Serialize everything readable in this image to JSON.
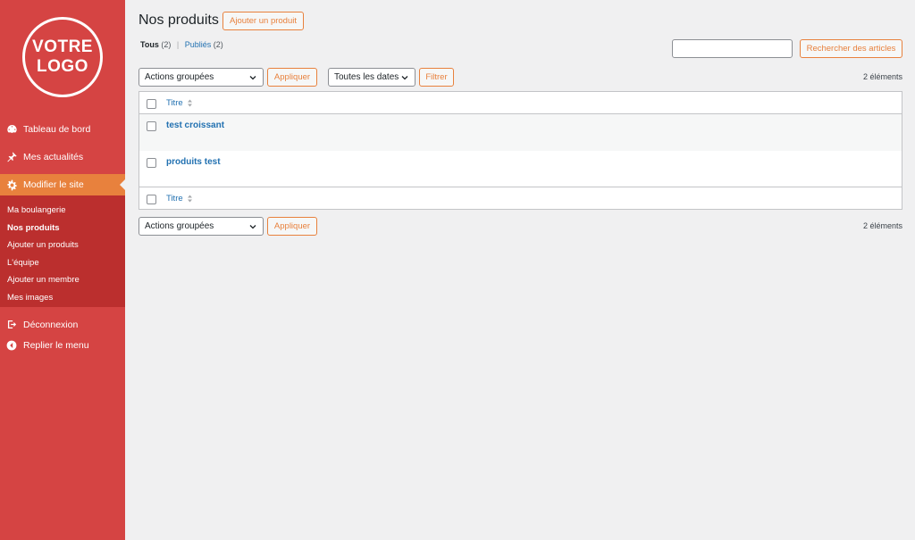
{
  "logo": {
    "line1": "VOTRE",
    "line2": "LOGO"
  },
  "sidebar": {
    "items": [
      {
        "label": "Tableau de bord",
        "icon": "dashboard-icon"
      },
      {
        "label": "Mes actualités",
        "icon": "pin-icon"
      },
      {
        "label": "Modifier le site",
        "icon": "gear-icon"
      }
    ],
    "submenu": [
      {
        "label": "Ma boulangerie"
      },
      {
        "label": "Nos produits"
      },
      {
        "label": "Ajouter un produits"
      },
      {
        "label": "L'équipe"
      },
      {
        "label": "Ajouter un membre"
      },
      {
        "label": "Mes images"
      }
    ],
    "bottom": [
      {
        "label": "Déconnexion",
        "icon": "logout-icon"
      },
      {
        "label": "Replier le menu",
        "icon": "collapse-icon"
      }
    ]
  },
  "header": {
    "title": "Nos produits",
    "add_label": "Ajouter un produit"
  },
  "filters": {
    "all_label": "Tous",
    "all_count": "(2)",
    "sep": "|",
    "published_label": "Publiés",
    "published_count": "(2)"
  },
  "search": {
    "button_label": "Rechercher des articles",
    "value": ""
  },
  "bulk_top": {
    "select": "Actions groupées",
    "apply": "Appliquer"
  },
  "dates": {
    "select": "Toutes les dates",
    "filter": "Filtrer"
  },
  "bulk_bottom": {
    "select": "Actions groupées",
    "apply": "Appliquer"
  },
  "count_top": "2 éléments",
  "count_bottom": "2 éléments",
  "table": {
    "header": "Titre",
    "footer": "Titre",
    "rows": [
      {
        "title": "test croissant"
      },
      {
        "title": "produits test"
      }
    ]
  },
  "colors": {
    "sidebar": "#d54443",
    "accent": "#e8813d",
    "submenu": "#bb2f2e",
    "link": "#2271b1"
  }
}
